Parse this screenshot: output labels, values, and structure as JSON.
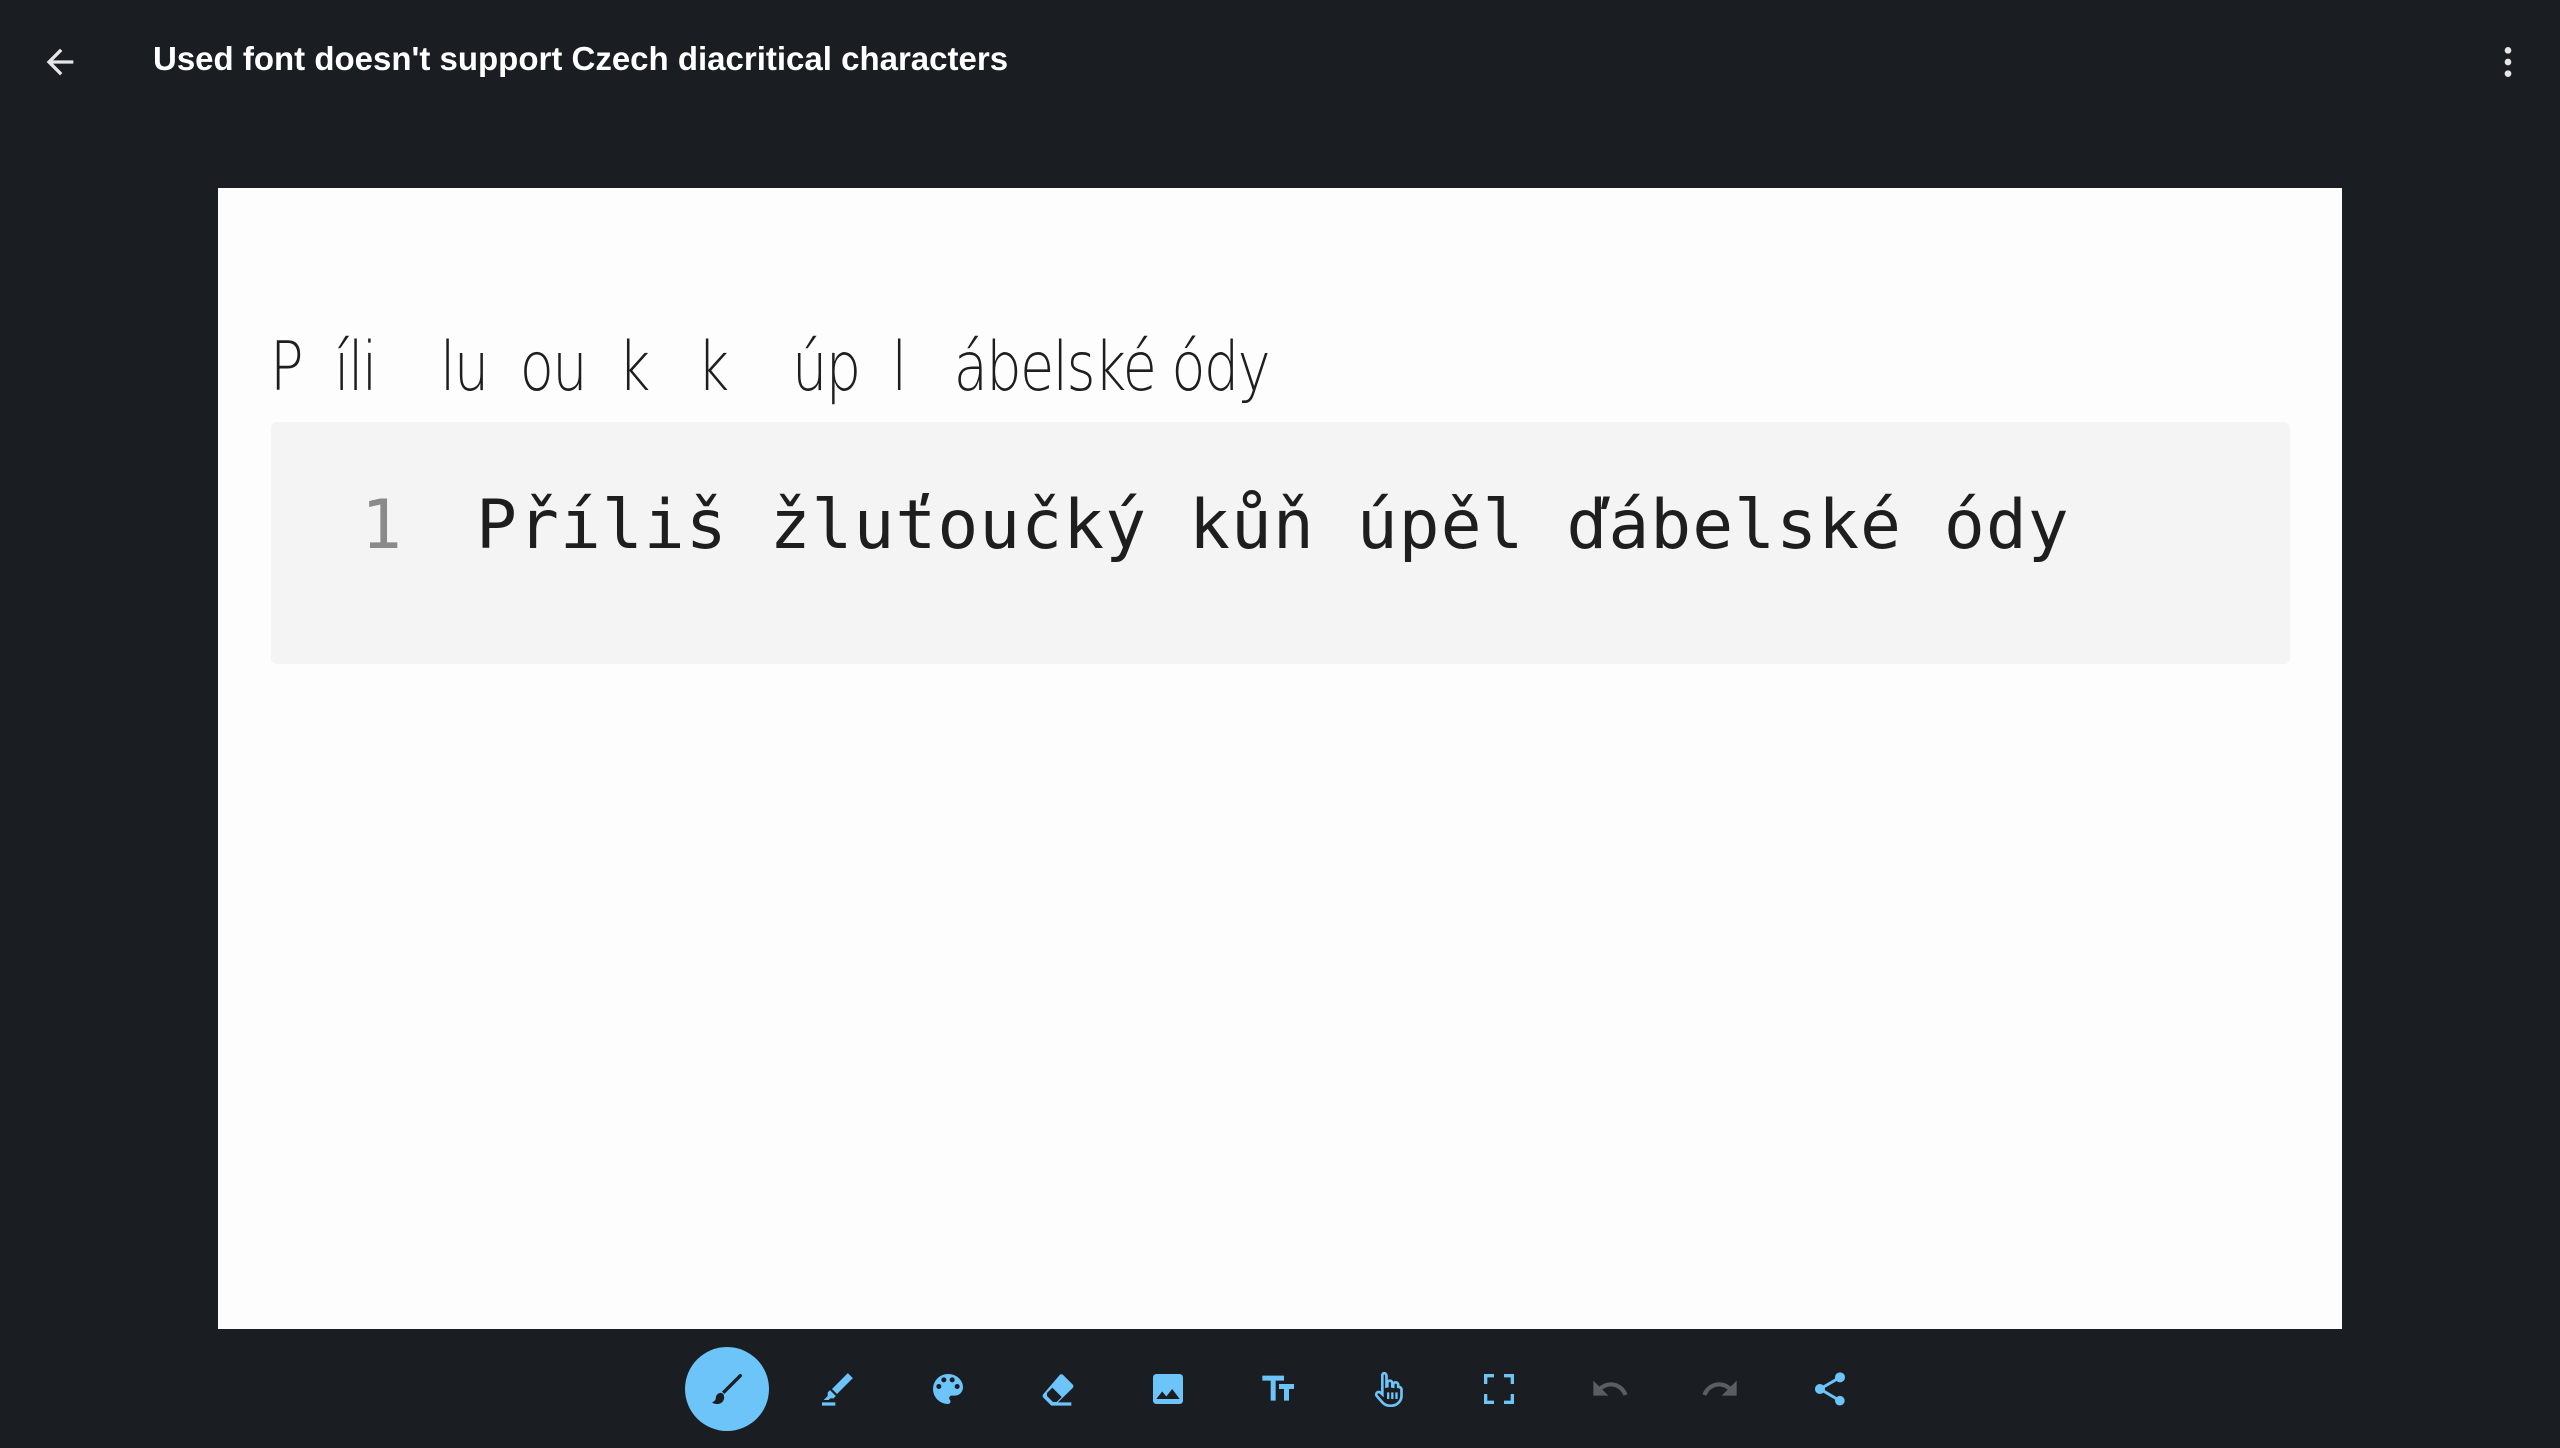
{
  "topbar": {
    "title": "Used font doesn't support Czech diacritical characters",
    "back_icon": "arrow-left-icon",
    "menu_icon": "more-vert-icon"
  },
  "canvas": {
    "handwritten_text": "P  íli    lu  ou  k   k    úp  l   ábelské ódy",
    "code_block": {
      "line_number": "1",
      "code": "Příliš žluťoučký kůň úpěl ďábelské ódy"
    }
  },
  "toolbar": {
    "tools": [
      {
        "name": "pen",
        "icon": "pen-icon",
        "active": true
      },
      {
        "name": "highlighter",
        "icon": "highlighter-icon",
        "active": false
      },
      {
        "name": "palette",
        "icon": "palette-icon",
        "active": false
      },
      {
        "name": "eraser",
        "icon": "eraser-icon",
        "active": false
      },
      {
        "name": "image",
        "icon": "image-icon",
        "active": false
      },
      {
        "name": "text",
        "icon": "text-size-icon",
        "active": false
      },
      {
        "name": "hand",
        "icon": "hand-pointer-icon",
        "active": false
      },
      {
        "name": "fullscreen",
        "icon": "fullscreen-icon",
        "active": false
      },
      {
        "name": "undo",
        "icon": "undo-icon",
        "active": false,
        "disabled": true
      },
      {
        "name": "redo",
        "icon": "redo-icon",
        "active": false,
        "disabled": true
      },
      {
        "name": "share",
        "icon": "share-icon",
        "active": false
      }
    ]
  },
  "colors": {
    "background": "#1a1d21",
    "accent": "#6cc4f9",
    "disabled": "#5a5e63",
    "canvas": "#fdfdfd",
    "code_bg": "#f4f4f4"
  }
}
